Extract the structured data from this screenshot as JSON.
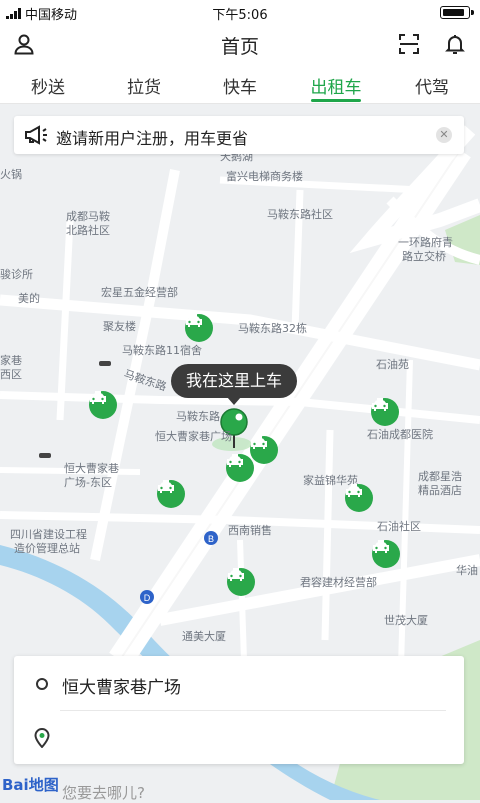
{
  "status": {
    "carrier": "中国移动",
    "time": "下午5:06"
  },
  "header": {
    "title": "首页"
  },
  "tabs": [
    "秒送",
    "拉货",
    "快车",
    "出租车",
    "代驾"
  ],
  "active_tab": "出租车",
  "banner": {
    "text": "邀请新用户注册，用车更省"
  },
  "map_labels": [
    "天鹅湖",
    "富兴电梯商务楼",
    "成都马鞍",
    "北路社区",
    "马鞍东路社区",
    "一环路府青",
    "路立交桥",
    "宏星五金经营部",
    "聚友楼",
    "马鞍东路32栋",
    "马鞍东路11宿舍",
    "马鞍东路",
    "石油苑",
    "马鞍东路",
    "恒大曹家巷广场",
    "石油成都医院",
    "恒大曹家巷",
    "广场-东区",
    "家益锦华苑",
    "成都星浩",
    "精品酒店",
    "西南销售",
    "石油社区",
    "四川省建设工程",
    "造价管理总站",
    "君容建材经营部",
    "世茂大厦",
    "通美大厦",
    "华油",
    "骏诊所",
    "火锅",
    "美的",
    "家巷",
    "西区"
  ],
  "pickup_bubble": "我在这里上车",
  "panel": {
    "from": "恒大曹家巷广场",
    "to_placeholder": "您要去哪儿?"
  },
  "logo": {
    "text": "Bai地图"
  },
  "colors": {
    "accent": "#1fa64a",
    "taxi": "#2aa84a"
  }
}
